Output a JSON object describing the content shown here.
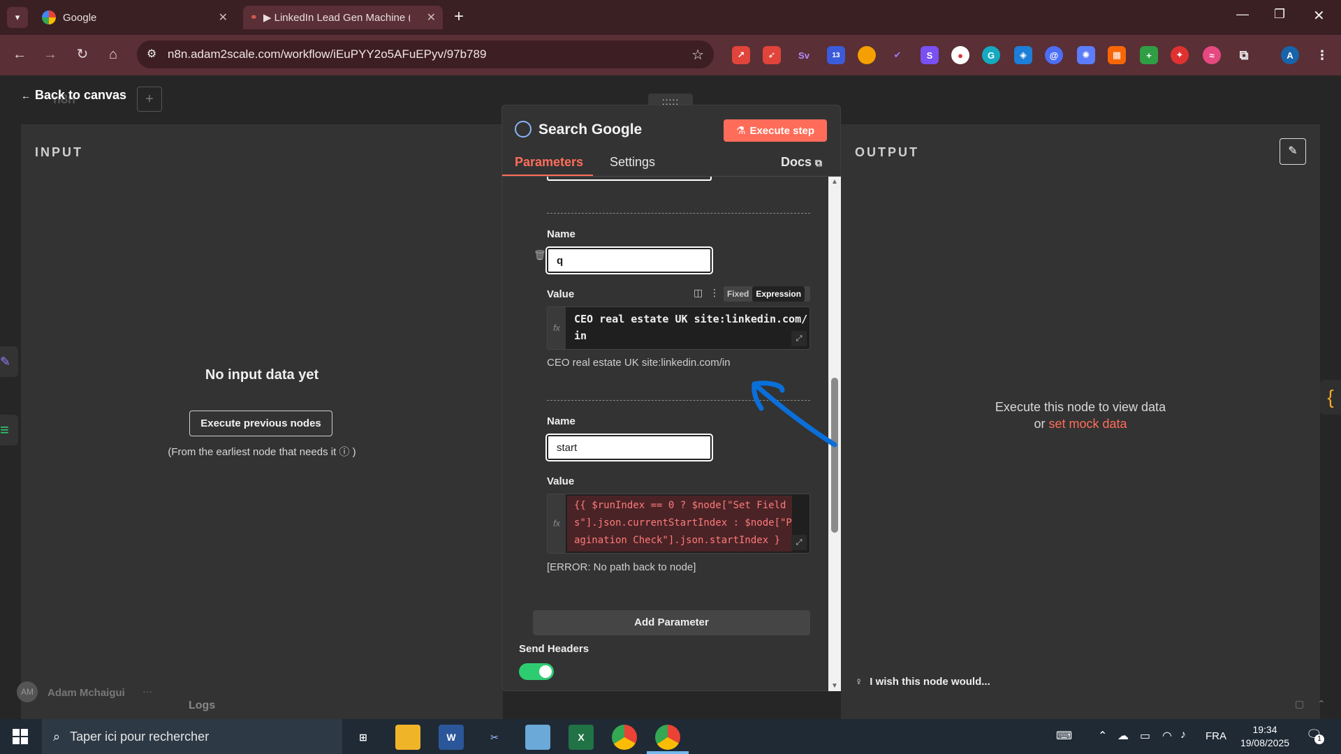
{
  "browser": {
    "tabs": [
      {
        "title": "Google",
        "active": false
      },
      {
        "title": "▶ LinkedIn Lead Gen Machine (",
        "active": true
      }
    ],
    "new_tab": "+",
    "url": "n8n.adam2scale.com/workflow/iEuPYY2o5AFuEPyv/97b789",
    "profile_initial": "A",
    "ext_badge": "13"
  },
  "canvas": {
    "back_label": "Back to canvas",
    "bg_project": "n8n",
    "user_initials": "AM",
    "user_name": "Adam Mchaigui",
    "logs_label": "Logs"
  },
  "input_panel": {
    "heading": "INPUT",
    "empty_title": "No input data yet",
    "execute_prev": "Execute previous nodes",
    "hint": "(From the earliest node that needs it",
    "hint_close": ")"
  },
  "node": {
    "title": "Search Google",
    "execute_step": "Execute step",
    "tabs": {
      "parameters": "Parameters",
      "settings": "Settings",
      "docs": "Docs"
    },
    "drag_handle": ":::::",
    "params": [
      {
        "name_label": "Name",
        "name_value": "q",
        "value_label": "Value",
        "mode_fixed": "Fixed",
        "mode_expression": "Expression",
        "expr_line1": "CEO real estate UK site:linkedin.com/",
        "expr_line2": "in",
        "preview": "CEO real estate UK site:linkedin.com/in"
      },
      {
        "name_label": "Name",
        "name_value": "start",
        "value_label": "Value",
        "expr_line1": "{{ $runIndex == 0 ? $node[\"Set Field",
        "expr_line2": "s\"].json.currentStartIndex : $node[\"P",
        "expr_line3": "agination Check\"].json.startIndex }",
        "preview": "[ERROR: No path back to node]"
      }
    ],
    "fx": "fx",
    "add_parameter": "Add Parameter",
    "send_headers": "Send Headers",
    "send_headers_on": true,
    "wish": "I wish this node would..."
  },
  "output_panel": {
    "heading": "OUTPUT",
    "empty_line1": "Execute this node to view data",
    "empty_or": "or",
    "mock_link": "set mock data"
  },
  "taskbar": {
    "search_placeholder": "Taper ici pour rechercher",
    "lang": "FRA",
    "time": "19:34",
    "date": "19/08/2025",
    "notif_count": "1"
  },
  "colors": {
    "accent": "#ff6d5a",
    "toggle_on": "#2ecc71",
    "error_text": "#ff7b7b",
    "arrow": "#0a6fd8"
  }
}
